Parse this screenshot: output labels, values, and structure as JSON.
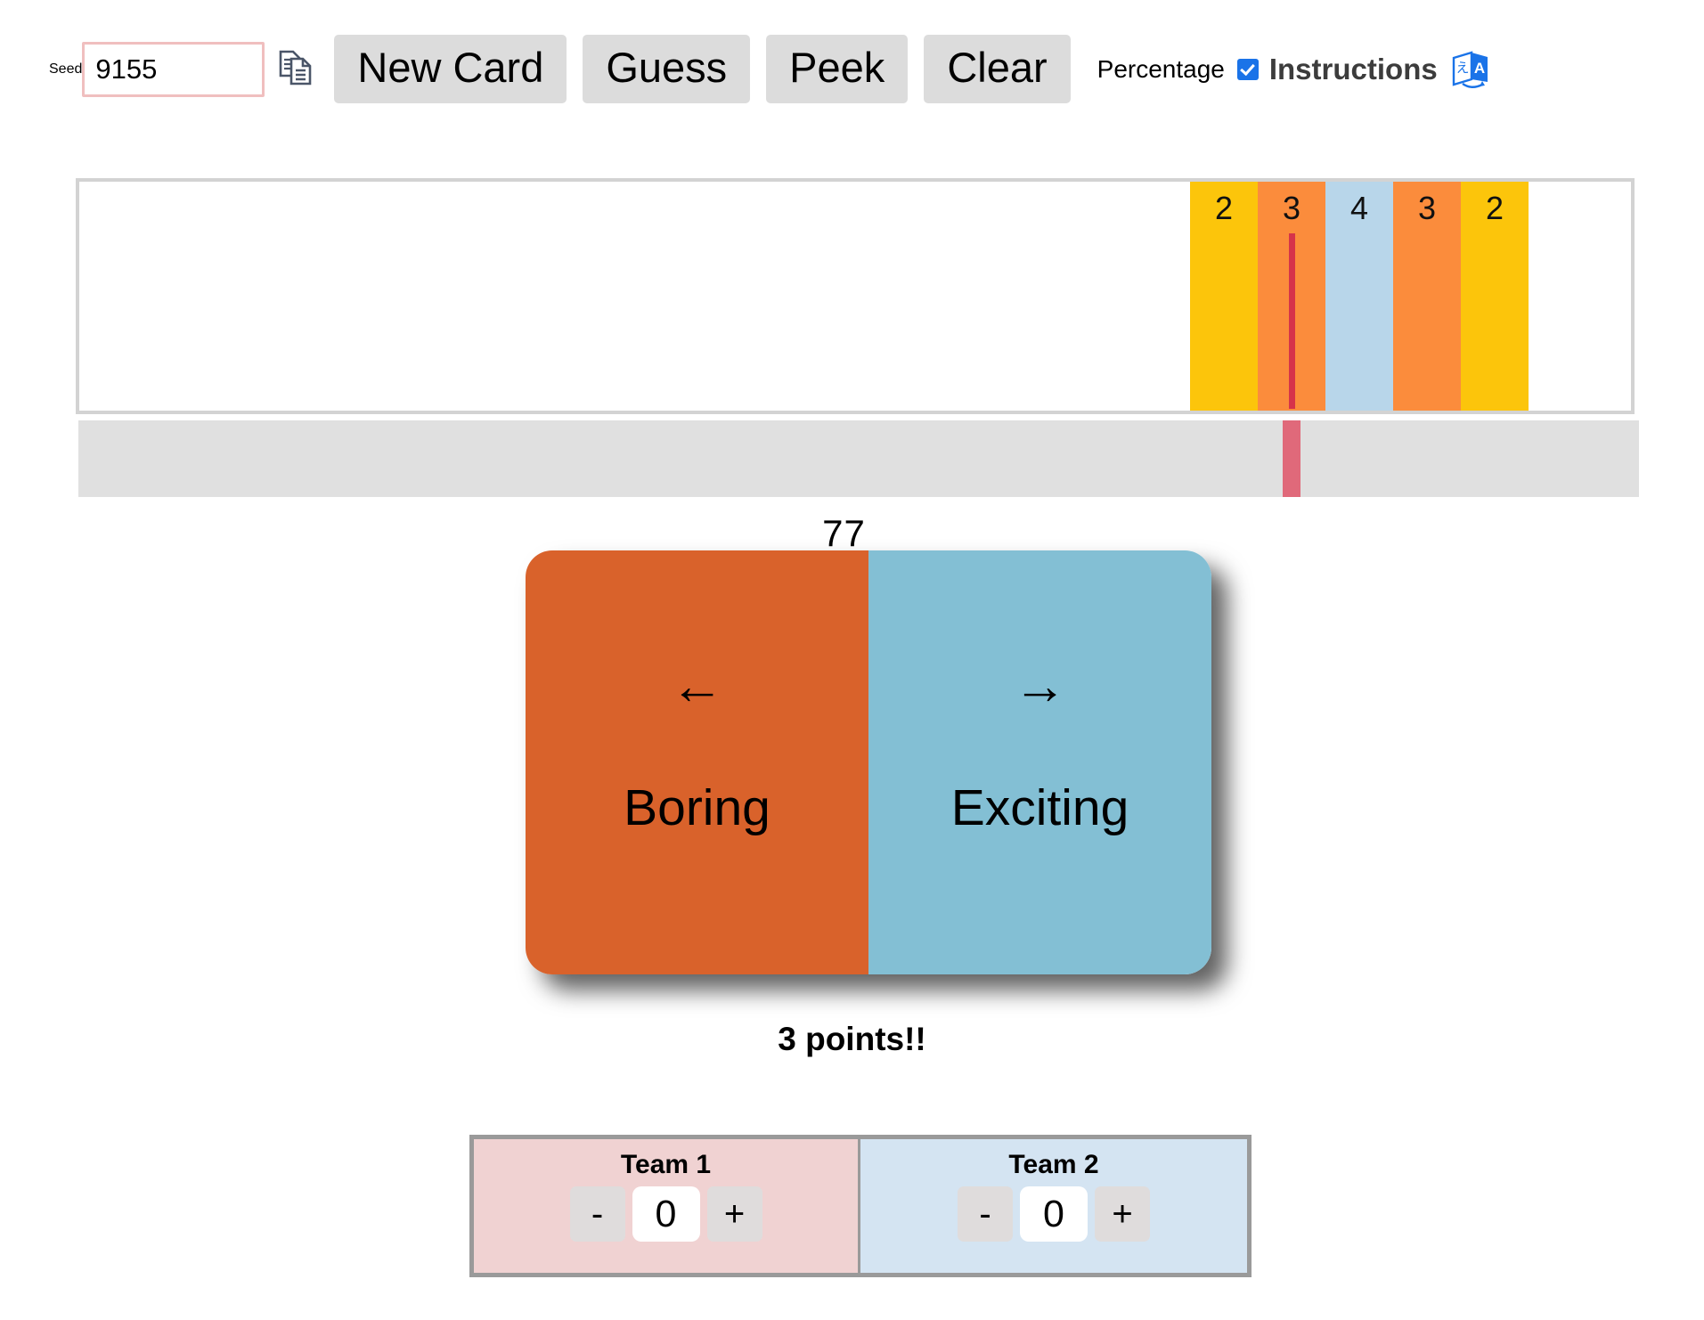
{
  "toolbar": {
    "seed_label": "Seed",
    "seed_value": "9155",
    "copy_icon": "copy-documents-icon",
    "new_card_label": "New Card",
    "guess_label": "Guess",
    "peek_label": "Peek",
    "clear_label": "Clear",
    "percentage_label": "Percentage",
    "percentage_checked": true,
    "instructions_label": "Instructions",
    "instructions_checked": true,
    "translate_icon": "google-translate-icon"
  },
  "spectrum": {
    "bands": [
      {
        "score": "2",
        "color": "#fcc50b"
      },
      {
        "score": "3",
        "color": "#fb8c3c"
      },
      {
        "score": "4",
        "color": "#b8d6ea"
      },
      {
        "score": "3",
        "color": "#fb8c3c"
      },
      {
        "score": "2",
        "color": "#fcc50b"
      }
    ],
    "target_marker_color": "#d6334a",
    "guess_marker_color": "#e0697a",
    "track_color": "#e0e0e0"
  },
  "card": {
    "value": "77",
    "left_arrow": "←",
    "right_arrow": "→",
    "left_word": "Boring",
    "right_word": "Exciting",
    "left_color": "#d9622b",
    "right_color": "#83bfd4"
  },
  "result": {
    "points_text": "3 points!!"
  },
  "scoreboard": {
    "teams": [
      {
        "name": "Team 1",
        "score": "0",
        "minus_label": "-",
        "plus_label": "+",
        "color": "#f0d2d2"
      },
      {
        "name": "Team 2",
        "score": "0",
        "minus_label": "-",
        "plus_label": "+",
        "color": "#d4e4f2"
      }
    ]
  }
}
